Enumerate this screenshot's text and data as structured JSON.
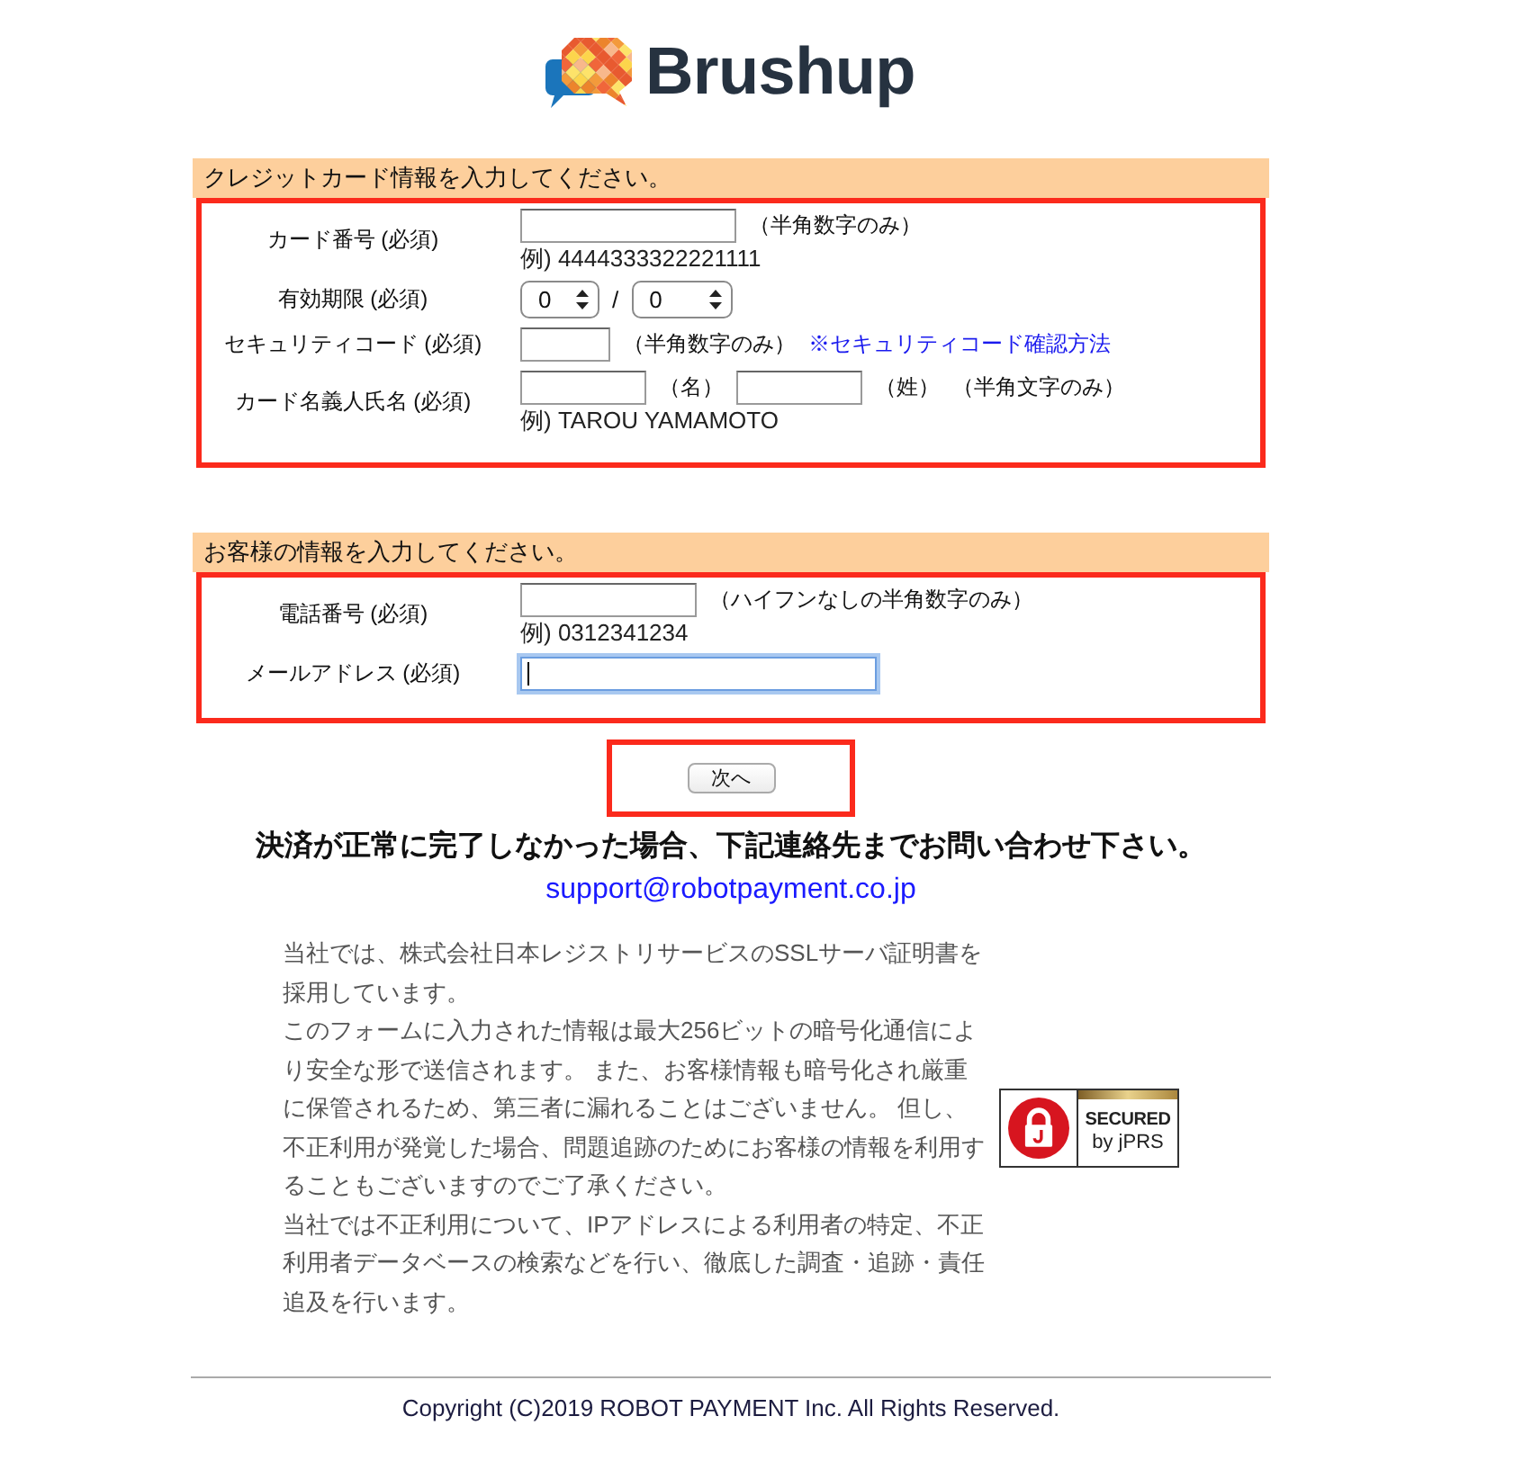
{
  "logo": {
    "text": "Brushup"
  },
  "sections": [
    {
      "title": "クレジットカード情報を入力してください。",
      "rows": [
        {
          "label": "カード番号 (必須)",
          "controls": [
            {
              "kind": "input",
              "focused": false
            },
            {
              "kind": "note",
              "text": "（半角数字のみ）"
            }
          ],
          "example": "例) 4444333322221111"
        },
        {
          "label": "有効期限 (必須)",
          "controls": [
            {
              "kind": "select",
              "value": "0"
            },
            {
              "kind": "separator",
              "text": "/"
            },
            {
              "kind": "select",
              "value": "0"
            }
          ]
        },
        {
          "label": "セキュリティコード (必須)",
          "controls": [
            {
              "kind": "input",
              "focused": false
            },
            {
              "kind": "note",
              "text": "（半角数字のみ）"
            },
            {
              "kind": "link",
              "text": "※セキュリティコード確認方法"
            }
          ]
        },
        {
          "label": "カード名義人氏名 (必須)",
          "controls": [
            {
              "kind": "input",
              "focused": false
            },
            {
              "kind": "note",
              "text": "（名）"
            },
            {
              "kind": "input",
              "focused": false
            },
            {
              "kind": "note",
              "text": "（姓）"
            },
            {
              "kind": "note",
              "text": "（半角文字のみ）"
            }
          ],
          "example": "例) TAROU YAMAMOTO"
        }
      ]
    },
    {
      "title": "お客様の情報を入力してください。",
      "rows": [
        {
          "label": "電話番号 (必須)",
          "controls": [
            {
              "kind": "input",
              "focused": false
            },
            {
              "kind": "note",
              "text": "（ハイフンなしの半角数字のみ）"
            }
          ],
          "example": "例) 0312341234"
        },
        {
          "label": "メールアドレス (必須)",
          "controls": [
            {
              "kind": "input",
              "focused": true
            }
          ]
        }
      ]
    }
  ],
  "next_button": {
    "label": "次へ"
  },
  "notice": {
    "heading": "決済が正常に完了しなかった場合、下記連絡先までお問い合わせ下さい。",
    "email": "support@robotpayment.co.jp"
  },
  "security": {
    "paragraphs": [
      "当社では、株式会社日本レジストリサービスのSSLサーバ証明書を採用しています。",
      "このフォームに入力された情報は最大256ビットの暗号化通信により安全な形で送信されます。 また、お客様情報も暗号化され厳重に保管されるため、第三者に漏れることはございません。 但し、不正利用が発覚した場合、問題追跡のためにお客様の情報を利用することもございますのでご了承ください。",
      "当社では不正利用について、IPアドレスによる利用者の特定、不正利用者データベースの検索などを行い、徹底した調査・追跡・責任追及を行います。"
    ],
    "seal": {
      "line1": "SECURED",
      "line2": "by jPRS"
    }
  },
  "footer": {
    "copyright": "Copyright (C)2019 ROBOT PAYMENT Inc. All Rights Reserved."
  }
}
